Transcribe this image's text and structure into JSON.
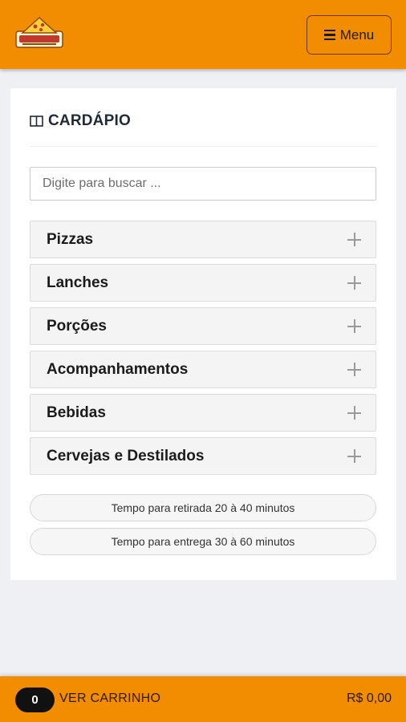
{
  "header": {
    "logo_icon": "pizzeria-logo-icon",
    "menu_label": "Menu",
    "menu_icon": "hamburger-icon",
    "colors": {
      "bar": "#f28c00"
    }
  },
  "card": {
    "title": "CARDÁPIO",
    "title_icon": "book-open-icon",
    "search_placeholder": "Digite para buscar ...",
    "categories": [
      {
        "label": "Pizzas"
      },
      {
        "label": "Lanches"
      },
      {
        "label": "Porções"
      },
      {
        "label": "Acompanhamentos"
      },
      {
        "label": "Bebidas"
      },
      {
        "label": "Cervejas e Destilados"
      }
    ],
    "category_expand_icon": "plus-icon",
    "times": {
      "pickup": "Tempo para retirada 20 à 40 minutos",
      "delivery": "Tempo para entrega 30 à 60 minutos"
    }
  },
  "cart": {
    "count": "0",
    "label": "VER CARRINHO",
    "total": "R$ 0,00"
  }
}
